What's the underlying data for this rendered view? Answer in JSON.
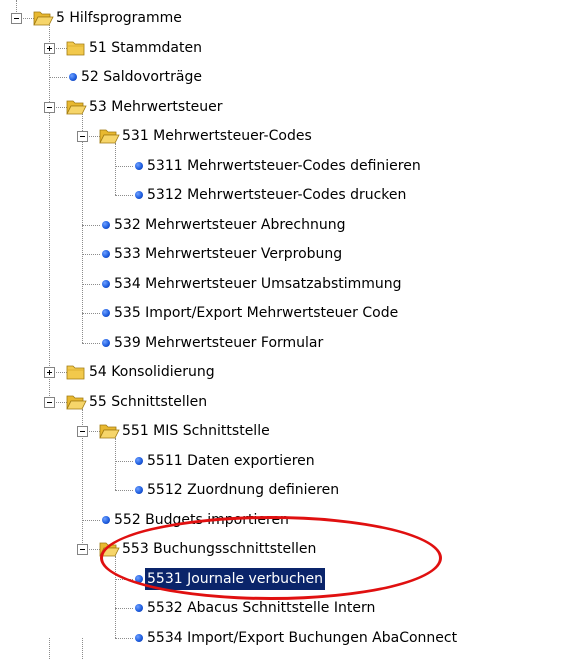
{
  "tree": {
    "items": [
      {
        "label": "5 Hilfsprogramme",
        "level": 0,
        "icon": "folder-open-icon",
        "expander": "minus"
      },
      {
        "label": "51 Stammdaten",
        "level": 1,
        "icon": "folder-icon",
        "expander": "plus"
      },
      {
        "label": "52 Saldovorträge",
        "level": 1,
        "icon": "bullet-icon",
        "expander": "none"
      },
      {
        "label": "53 Mehrwertsteuer",
        "level": 1,
        "icon": "folder-open-icon",
        "expander": "minus"
      },
      {
        "label": "531 Mehrwertsteuer-Codes",
        "level": 2,
        "icon": "folder-open-icon",
        "expander": "minus"
      },
      {
        "label": "5311 Mehrwertsteuer-Codes definieren",
        "level": 3,
        "icon": "bullet-icon",
        "expander": "none"
      },
      {
        "label": "5312 Mehrwertsteuer-Codes drucken",
        "level": 3,
        "icon": "bullet-icon",
        "expander": "none"
      },
      {
        "label": "532 Mehrwertsteuer Abrechnung",
        "level": 2,
        "icon": "bullet-icon",
        "expander": "none"
      },
      {
        "label": "533 Mehrwertsteuer Verprobung",
        "level": 2,
        "icon": "bullet-icon",
        "expander": "none"
      },
      {
        "label": "534 Mehrwertsteuer Umsatzabstimmung",
        "level": 2,
        "icon": "bullet-icon",
        "expander": "none"
      },
      {
        "label": "535 Import/Export Mehrwertsteuer Code",
        "level": 2,
        "icon": "bullet-icon",
        "expander": "none"
      },
      {
        "label": "539 Mehrwertsteuer Formular",
        "level": 2,
        "icon": "bullet-icon",
        "expander": "none"
      },
      {
        "label": "54 Konsolidierung",
        "level": 1,
        "icon": "folder-icon",
        "expander": "plus"
      },
      {
        "label": "55 Schnittstellen",
        "level": 1,
        "icon": "folder-open-icon",
        "expander": "minus"
      },
      {
        "label": "551 MIS Schnittstelle",
        "level": 2,
        "icon": "folder-open-icon",
        "expander": "minus"
      },
      {
        "label": "5511 Daten exportieren",
        "level": 3,
        "icon": "bullet-icon",
        "expander": "none"
      },
      {
        "label": "5512 Zuordnung definieren",
        "level": 3,
        "icon": "bullet-icon",
        "expander": "none"
      },
      {
        "label": "552 Budgets importieren",
        "level": 2,
        "icon": "bullet-icon",
        "expander": "none"
      },
      {
        "label": "553 Buchungsschnittstellen",
        "level": 2,
        "icon": "folder-open-icon",
        "expander": "minus"
      },
      {
        "label": "5531 Journale verbuchen",
        "level": 3,
        "icon": "bullet-icon",
        "expander": "none",
        "selected": true
      },
      {
        "label": "5532 Abacus Schnittstelle Intern",
        "level": 3,
        "icon": "bullet-icon",
        "expander": "none"
      },
      {
        "label": "5534 Import/Export Buchungen AbaConnect",
        "level": 3,
        "icon": "bullet-icon",
        "expander": "none"
      }
    ]
  },
  "colors": {
    "selection_bg": "#0a246a",
    "selection_fg": "#ffffff",
    "annotation": "#e01010",
    "folder": "#f2c94c"
  }
}
